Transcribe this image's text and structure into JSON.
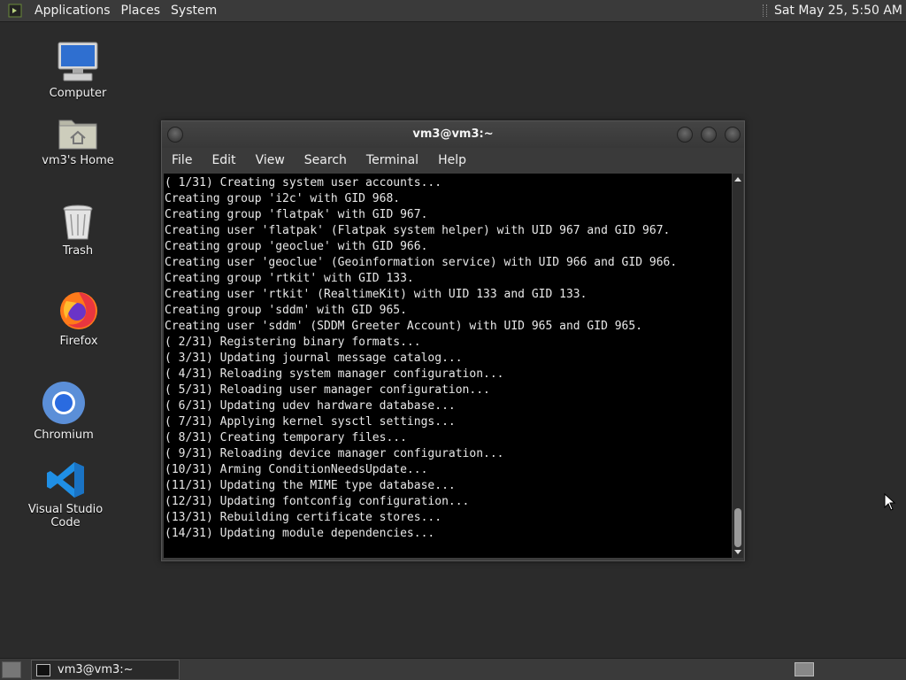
{
  "top_panel": {
    "menus": [
      "Applications",
      "Places",
      "System"
    ],
    "clock": "Sat May 25,  5:50 AM"
  },
  "desktop": {
    "icons": [
      {
        "label": "Computer",
        "icon": "computer-icon"
      },
      {
        "label": "vm3's Home",
        "icon": "home-folder-icon"
      },
      {
        "label": "Trash",
        "icon": "trash-icon"
      },
      {
        "label": "Firefox",
        "icon": "firefox-icon"
      },
      {
        "label": "Chromium",
        "icon": "chromium-icon"
      },
      {
        "label": "Visual Studio Code",
        "icon": "vscode-icon"
      }
    ]
  },
  "terminal": {
    "title": "vm3@vm3:~",
    "menu": [
      "File",
      "Edit",
      "View",
      "Search",
      "Terminal",
      "Help"
    ],
    "lines": [
      "( 1/31) Creating system user accounts...",
      "Creating group 'i2c' with GID 968.",
      "Creating group 'flatpak' with GID 967.",
      "Creating user 'flatpak' (Flatpak system helper) with UID 967 and GID 967.",
      "Creating group 'geoclue' with GID 966.",
      "Creating user 'geoclue' (Geoinformation service) with UID 966 and GID 966.",
      "Creating group 'rtkit' with GID 133.",
      "Creating user 'rtkit' (RealtimeKit) with UID 133 and GID 133.",
      "Creating group 'sddm' with GID 965.",
      "Creating user 'sddm' (SDDM Greeter Account) with UID 965 and GID 965.",
      "( 2/31) Registering binary formats...",
      "( 3/31) Updating journal message catalog...",
      "( 4/31) Reloading system manager configuration...",
      "( 5/31) Reloading user manager configuration...",
      "( 6/31) Updating udev hardware database...",
      "( 7/31) Applying kernel sysctl settings...",
      "( 8/31) Creating temporary files...",
      "( 9/31) Reloading device manager configuration...",
      "(10/31) Arming ConditionNeedsUpdate...",
      "(11/31) Updating the MIME type database...",
      "(12/31) Updating fontconfig configuration...",
      "(13/31) Rebuilding certificate stores...",
      "(14/31) Updating module dependencies..."
    ]
  },
  "bottom_panel": {
    "task_label": "vm3@vm3:~"
  }
}
